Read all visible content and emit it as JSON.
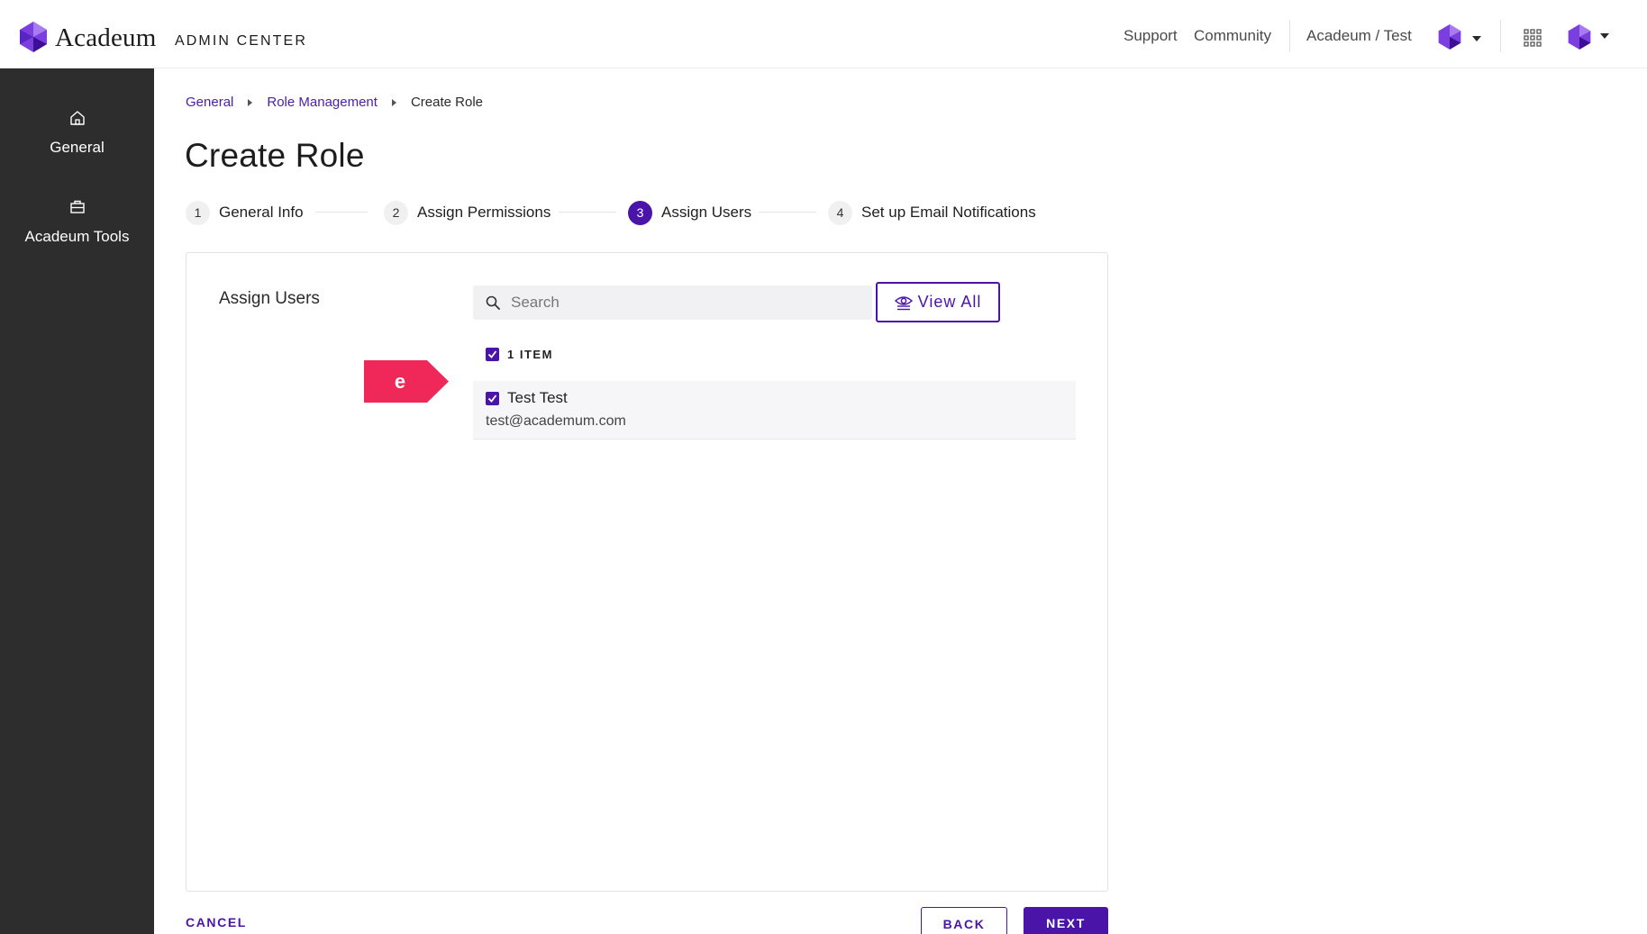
{
  "header": {
    "brand": "Acadeum",
    "brand_subtitle": "ADMIN CENTER",
    "links": {
      "support": "Support",
      "community": "Community",
      "account": "Acadeum / Test"
    },
    "icons": [
      "acadeum-logo-icon",
      "chevron-down-icon",
      "apps-grid-icon"
    ]
  },
  "sidebar": {
    "items": [
      {
        "label": "General",
        "icon": "home-icon"
      },
      {
        "label": "Acadeum Tools",
        "icon": "toolbox-icon"
      }
    ]
  },
  "breadcrumb": {
    "items": [
      "General",
      "Role Management",
      "Create Role"
    ]
  },
  "page": {
    "title": "Create Role"
  },
  "stepper": {
    "active_step": 3,
    "steps": [
      {
        "number": "1",
        "label": "General Info"
      },
      {
        "number": "2",
        "label": "Assign Permissions"
      },
      {
        "number": "3",
        "label": "Assign Users"
      },
      {
        "number": "4",
        "label": "Set up Email Notifications"
      }
    ]
  },
  "assign_users": {
    "section_label": "Assign Users",
    "search_placeholder": "Search",
    "view_all_label": "View All",
    "select_all_checked": true,
    "item_count_label": "1 ITEM",
    "users": [
      {
        "name": "Test Test",
        "email": "test@academum.com",
        "checked": true
      }
    ],
    "annotation_tag": "e"
  },
  "actions": {
    "cancel": "CANCEL",
    "back": "BACK",
    "next": "NEXT"
  },
  "colors": {
    "accent": "#4b14a8",
    "sidebar_bg": "#2d2d2d",
    "tag": "#f0285a"
  }
}
